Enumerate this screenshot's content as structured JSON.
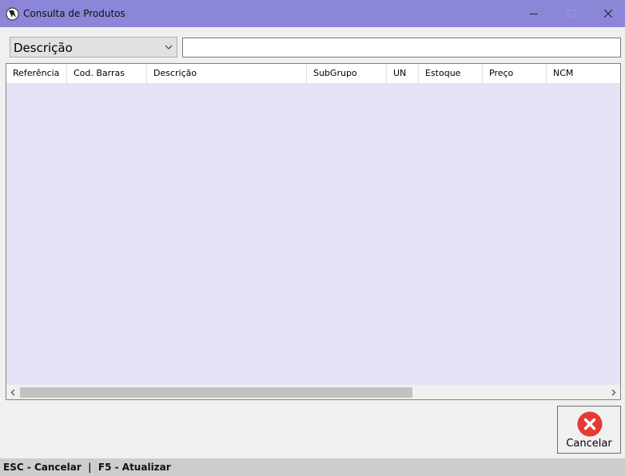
{
  "window": {
    "title": "Consulta de Produtos"
  },
  "filter": {
    "selected": "Descrição",
    "search_value": ""
  },
  "grid": {
    "columns": [
      "Referência",
      "Cod. Barras",
      "Descrição",
      "SubGrupo",
      "UN",
      "Estoque",
      "Preço",
      "NCM"
    ],
    "rows": []
  },
  "actions": {
    "cancel_label": "Cancelar"
  },
  "status": {
    "text": "ESC - Cancelar  |  F5 - Atualizar"
  },
  "colors": {
    "titlebar": "#8c86d8",
    "grid_background": "#e4e4f6",
    "cancel_icon": "#e53935"
  },
  "icons": {
    "app": "app-logo-icon",
    "minimize": "minimize-icon",
    "maximize": "maximize-icon",
    "close": "close-icon",
    "dropdown": "chevron-down-icon",
    "cancel": "cancel-x-icon",
    "scroll_left": "chevron-left-icon",
    "scroll_right": "chevron-right-icon"
  }
}
